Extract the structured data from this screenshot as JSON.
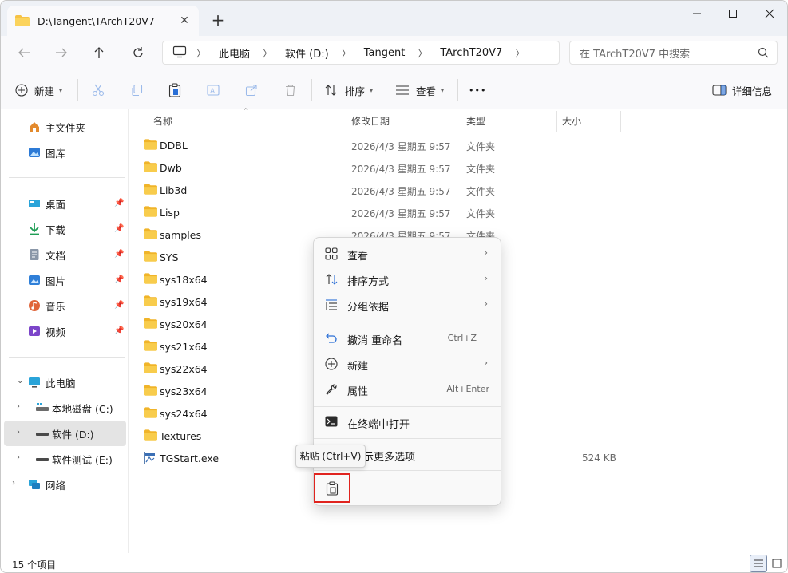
{
  "window": {
    "tab_title": "D:\\Tangent\\TArchT20V7",
    "tab_close": "✕",
    "new_tab": "+"
  },
  "address": {
    "crumbs": [
      "此电脑",
      "软件 (D:)",
      "Tangent",
      "TArchT20V7"
    ],
    "search_placeholder": "在 TArchT20V7 中搜索"
  },
  "toolbar": {
    "new_label": "新建",
    "sort_label": "排序",
    "view_label": "查看",
    "more_label": "•••",
    "details_label": "详细信息"
  },
  "sidebar": {
    "items": [
      {
        "label": "主文件夹",
        "icon": "home-icon"
      },
      {
        "label": "图库",
        "icon": "gallery-icon"
      },
      {
        "label": "桌面",
        "icon": "desktop-icon"
      },
      {
        "label": "下载",
        "icon": "download-icon"
      },
      {
        "label": "文档",
        "icon": "documents-icon"
      },
      {
        "label": "图片",
        "icon": "pictures-icon"
      },
      {
        "label": "音乐",
        "icon": "music-icon"
      },
      {
        "label": "视频",
        "icon": "videos-icon"
      },
      {
        "label": "此电脑",
        "icon": "this-pc-icon"
      },
      {
        "label": "本地磁盘 (C:)",
        "icon": "drive-icon"
      },
      {
        "label": "软件 (D:)",
        "icon": "drive-icon"
      },
      {
        "label": "软件测试 (E:)",
        "icon": "drive-icon"
      },
      {
        "label": "网络",
        "icon": "network-icon"
      }
    ]
  },
  "columns": {
    "name": "名称",
    "date": "修改日期",
    "type": "类型",
    "size": "大小"
  },
  "files": [
    {
      "name": "DDBL",
      "date": "2026/4/3 星期五 9:57",
      "type": "文件夹",
      "size": ""
    },
    {
      "name": "Dwb",
      "date": "2026/4/3 星期五 9:57",
      "type": "文件夹",
      "size": ""
    },
    {
      "name": "Lib3d",
      "date": "2026/4/3 星期五 9:57",
      "type": "文件夹",
      "size": ""
    },
    {
      "name": "Lisp",
      "date": "2026/4/3 星期五 9:57",
      "type": "文件夹",
      "size": ""
    },
    {
      "name": "samples",
      "date": "2026/4/3 星期五 9:57",
      "type": "文件夹",
      "size": ""
    },
    {
      "name": "SYS",
      "date": "",
      "type": "",
      "size": ""
    },
    {
      "name": "sys18x64",
      "date": "",
      "type": "",
      "size": ""
    },
    {
      "name": "sys19x64",
      "date": "",
      "type": "",
      "size": ""
    },
    {
      "name": "sys20x64",
      "date": "",
      "type": "",
      "size": ""
    },
    {
      "name": "sys21x64",
      "date": "",
      "type": "",
      "size": ""
    },
    {
      "name": "sys22x64",
      "date": "",
      "type": "",
      "size": ""
    },
    {
      "name": "sys23x64",
      "date": "",
      "type": "",
      "size": ""
    },
    {
      "name": "sys24x64",
      "date": "",
      "type": "",
      "size": ""
    },
    {
      "name": "Textures",
      "date": "",
      "type": "",
      "size": ""
    },
    {
      "name": "TGStart.exe",
      "date": "",
      "type": "序",
      "size": "524 KB"
    }
  ],
  "context_menu": {
    "view": "查看",
    "sort_by": "排序方式",
    "group_by": "分组依据",
    "undo": "撤消 重命名",
    "undo_shortcut": "Ctrl+Z",
    "new": "新建",
    "properties": "属性",
    "properties_shortcut": "Alt+Enter",
    "open_terminal": "在终端中打开",
    "more_options": "示更多选项"
  },
  "tooltip": {
    "paste": "粘贴 (Ctrl+V)"
  },
  "status": {
    "item_count": "15 个项目"
  },
  "colors": {
    "folder": "#f6c245",
    "accent": "#0067c0",
    "highlight_box": "#e0231e"
  }
}
